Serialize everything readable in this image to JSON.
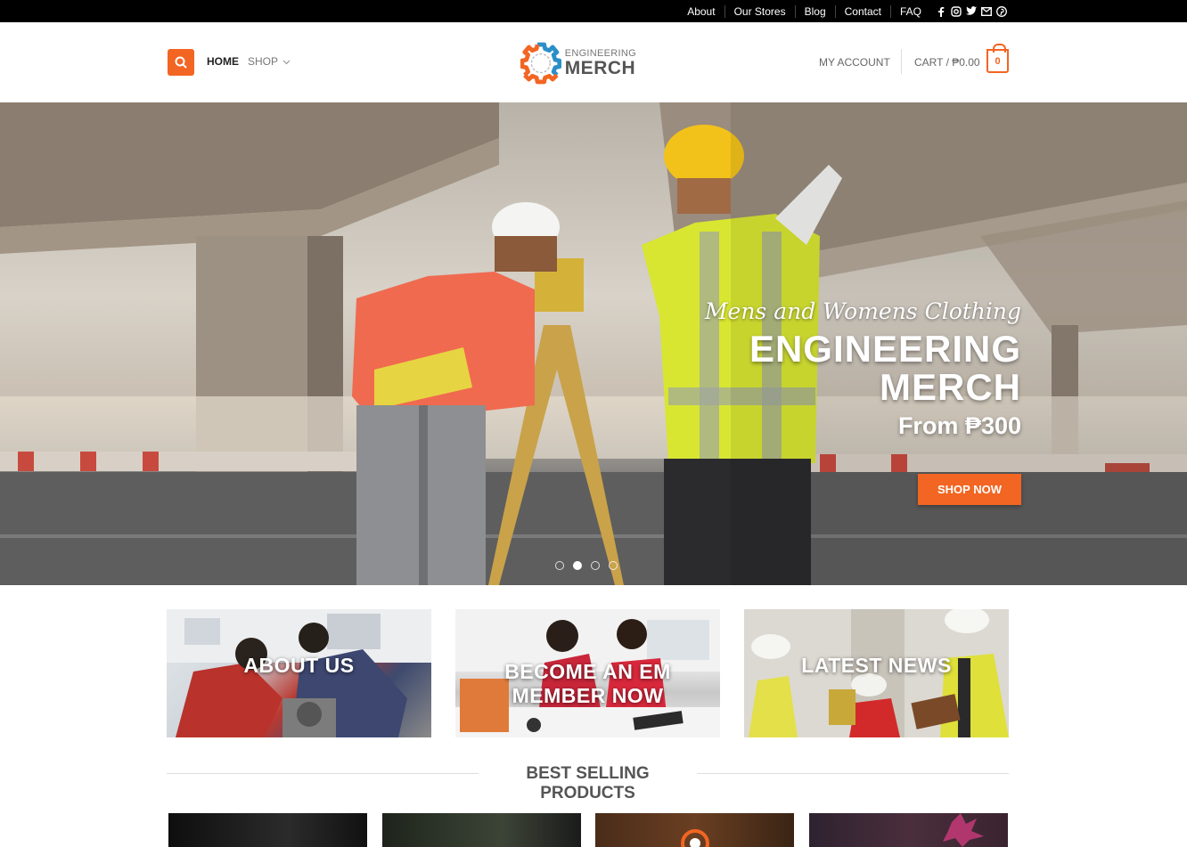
{
  "topbar": {
    "links": [
      "About",
      "Our Stores",
      "Blog",
      "Contact",
      "FAQ"
    ],
    "social_icons": [
      "facebook-icon",
      "instagram-icon",
      "twitter-icon",
      "email-icon",
      "pinterest-icon"
    ]
  },
  "header": {
    "nav": {
      "home": "HOME",
      "shop": "SHOP"
    },
    "logo": {
      "top": "ENGINEERING",
      "bottom": "MERCH"
    },
    "account": "MY ACCOUNT",
    "cart_label": "CART / ₱0.00",
    "cart_count": "0"
  },
  "hero": {
    "subtitle": "Mens and Womens Clothing",
    "title": "ENGINEERING MERCH",
    "price": "From ₱300",
    "button": "SHOP NOW",
    "slide_count": 4,
    "active_slide": 2
  },
  "tiles": [
    {
      "label": "ABOUT US"
    },
    {
      "label": "BECOME AN EM MEMBER NOW"
    },
    {
      "label": "LATEST NEWS"
    }
  ],
  "section_title": "BEST SELLING PRODUCTS",
  "colors": {
    "accent": "#f26522",
    "topbar": "#000000"
  }
}
